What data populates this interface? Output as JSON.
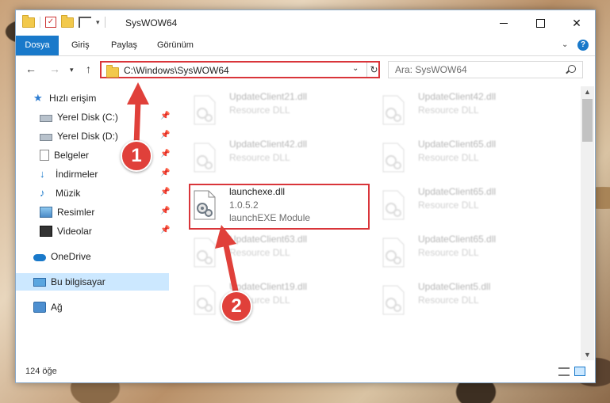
{
  "window": {
    "title": "SysWOW64"
  },
  "ribbon": {
    "tabs": [
      "Dosya",
      "Giriş",
      "Paylaş",
      "Görünüm"
    ]
  },
  "address_bar": {
    "path": "C:\\Windows\\SysWOW64"
  },
  "search": {
    "placeholder": "Ara: SysWOW64"
  },
  "nav_pane": {
    "items": [
      {
        "label": "Hızlı erişim",
        "icon": "star-icon"
      },
      {
        "label": "Yerel Disk (C:)",
        "icon": "disk-icon"
      },
      {
        "label": "Yerel Disk (D:)",
        "icon": "disk-icon"
      },
      {
        "label": "Belgeler",
        "icon": "document-icon"
      },
      {
        "label": "İndirmeler",
        "icon": "download-icon"
      },
      {
        "label": "Müzik",
        "icon": "music-icon"
      },
      {
        "label": "Resimler",
        "icon": "picture-icon"
      },
      {
        "label": "Videolar",
        "icon": "video-icon"
      },
      {
        "label": "OneDrive",
        "icon": "cloud-icon"
      },
      {
        "label": "Bu bilgisayar",
        "icon": "computer-icon"
      },
      {
        "label": "Ağ",
        "icon": "network-icon"
      }
    ]
  },
  "files": {
    "left": [
      {
        "name": "UpdateClient21.dll",
        "line2": "Resource DLL",
        "line3": ""
      },
      {
        "name": "UpdateClient42.dll",
        "line2": "Resource DLL",
        "line3": ""
      },
      {
        "name": "launchexe.dll",
        "line2": "1.0.5.2",
        "line3": "launchEXE Module"
      },
      {
        "name": "UpdateClient63.dll",
        "line2": "Resource DLL",
        "line3": ""
      },
      {
        "name": "UpdateClient19.dll",
        "line2": "Resource DLL",
        "line3": ""
      }
    ],
    "right": [
      {
        "name": "UpdateClient42.dll",
        "line2": "Resource DLL",
        "line3": ""
      },
      {
        "name": "UpdateClient65.dll",
        "line2": "Resource DLL",
        "line3": ""
      },
      {
        "name": "UpdateClient65.dll",
        "line2": "Resource DLL",
        "line3": ""
      },
      {
        "name": "UpdateClient65.dll",
        "line2": "Resource DLL",
        "line3": ""
      },
      {
        "name": "UpdateClient5.dll",
        "line2": "Resource DLL",
        "line3": ""
      }
    ]
  },
  "status": {
    "item_count": "124 öğe"
  },
  "callouts": {
    "step1": "1",
    "step2": "2",
    "color": "#e0403a"
  }
}
